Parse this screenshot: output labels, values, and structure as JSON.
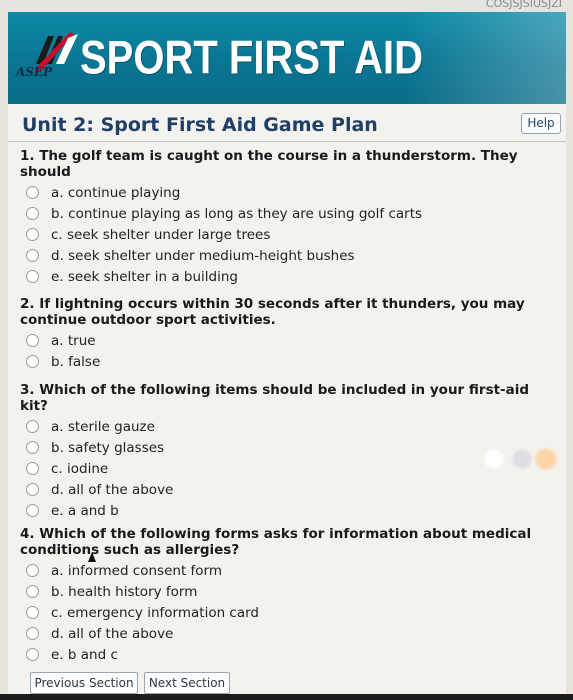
{
  "top_code": "COSJSJSIUSJZI",
  "logo": {
    "brand_text": "SPORT FIRST AID",
    "org_text": "ASEP"
  },
  "page": {
    "title": "Unit 2: Sport First Aid Game Plan",
    "help_label": "Help"
  },
  "questions": [
    {
      "text_line1": "1. The golf team is caught on the course in a thunderstorm. They",
      "text_line2": "should",
      "options": [
        "a. continue playing",
        "b. continue playing as long as they are using golf carts",
        "c. seek shelter under large trees",
        "d. seek shelter under medium-height bushes",
        "e. seek shelter in a building"
      ]
    },
    {
      "text_line1": "2. If lightning occurs within 30 seconds after it thunders, you may",
      "text_line2": "continue outdoor sport activities.",
      "options": [
        "a. true",
        "b. false"
      ]
    },
    {
      "text_line1": "3. Which of the following items should be included in your first-aid",
      "text_line2": "kit?",
      "options": [
        "a. sterile gauze",
        "b. safety glasses",
        "c. iodine",
        "d. all of the above",
        "e. a and b"
      ]
    },
    {
      "text_line1": "4. Which of the following forms asks for information about medical",
      "text_line2": "conditions such as allergies?",
      "options": [
        "a. informed consent form",
        "b. health history form",
        "c. emergency information card",
        "d. all of the above",
        "e. b and c"
      ]
    }
  ],
  "footer": {
    "prev_label": "Previous Section",
    "next_label": "Next Section"
  },
  "colors": {
    "banner": "#0a7592",
    "title": "#1f3f66",
    "button_border": "#9aa7b3"
  }
}
